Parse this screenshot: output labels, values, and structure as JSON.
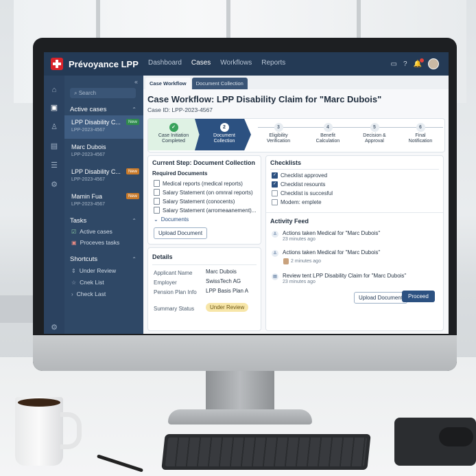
{
  "app": {
    "name": "Prévoyance LPP"
  },
  "nav": [
    "Dashboard",
    "Cases",
    "Workflows",
    "Reports"
  ],
  "sidebar": {
    "search_placeholder": "Search",
    "active_cases_title": "Active cases",
    "cases": [
      {
        "title": "LPP Disability C...",
        "id": "LPP-2023-4567",
        "badge": "New",
        "badge_color": "#2f8a4e"
      },
      {
        "title": "Marc Dubois",
        "id": "LPP-2023-4567",
        "badge": "",
        "badge_color": ""
      },
      {
        "title": "LPP Disability C...",
        "id": "LPP-2023-4567",
        "badge": "New",
        "badge_color": "#c97a2a"
      },
      {
        "title": "Mamin Fua",
        "id": "LPP-2023-4567",
        "badge": "New",
        "badge_color": "#c97a2a"
      }
    ],
    "tasks_title": "Tasks",
    "tasks": [
      "Active cases",
      "Proceves tasks"
    ],
    "shortcuts_title": "Shortcuts",
    "shortcuts": [
      "Under Review",
      "Cnek List",
      "Check Last"
    ]
  },
  "tabs": [
    "Case Workflow",
    "Document Collection"
  ],
  "workflow": {
    "title": "Case Workflow: LPP Disability Claim for \"Marc Dubois\"",
    "case_id": "Case ID: LPP-2023-4567",
    "steps": [
      {
        "num": "",
        "label1": "Case Initiation",
        "label2": "Completed",
        "state": "done"
      },
      {
        "num": "2",
        "label1": "Document",
        "label2": "Collection",
        "state": "current"
      },
      {
        "num": "3",
        "label1": "Eligibility",
        "label2": "Verification",
        "state": "todo"
      },
      {
        "num": "4",
        "label1": "Benefit",
        "label2": "Calculation",
        "state": "todo"
      },
      {
        "num": "5",
        "label1": "Decision &",
        "label2": "Approval",
        "state": "todo"
      },
      {
        "num": "6",
        "label1": "Final",
        "label2": "Notification",
        "state": "todo"
      }
    ]
  },
  "current_step": {
    "title": "Current Step: Document Collection",
    "required_title": "Required Documents",
    "documents": [
      "Medical reports (medical reports)",
      "Salary Statement (on omnral reports)",
      "Salary Statement (conocents)",
      "Salary Statement (arromeaanement)..."
    ],
    "documents_toggle": "Documents",
    "upload_label": "Upload Document"
  },
  "details": {
    "title": "Details",
    "rows": [
      {
        "key": "Applicant Name",
        "value": "Marc Dubois"
      },
      {
        "key": "Employer",
        "value": "SwissTech AG"
      },
      {
        "key": "Pension Plan Info",
        "value": "LPP Basis Plan A"
      }
    ],
    "summary_key": "Summary Status",
    "summary_value": "Under Review"
  },
  "checklists": {
    "title": "Checklists",
    "items": [
      {
        "label": "Checklist approved",
        "checked": true
      },
      {
        "label": "Checklist resounts",
        "checked": true
      },
      {
        "label": "Checklist is succesful",
        "checked": false
      },
      {
        "label": "Modem: emplete",
        "checked": false
      }
    ]
  },
  "activity": {
    "title": "Activity Feed",
    "items": [
      {
        "text": "Actions taken Medical for \"Marc Dubois\"",
        "time": "23 minutes ago"
      },
      {
        "text": "Actions taken Medical for \"Marc Dubois\"",
        "time": "2 minutes ago"
      },
      {
        "text": "Review tent LPP Disability Claim for \"Marc Dubois\"",
        "time": "23 minutes ago"
      }
    ],
    "upload_label": "Upload Document",
    "proceed_label": "Proceed"
  },
  "colors": {
    "brand": "#243a55",
    "accent": "#2c5181",
    "success": "#3aa35c",
    "swiss_red": "#d8232a"
  }
}
